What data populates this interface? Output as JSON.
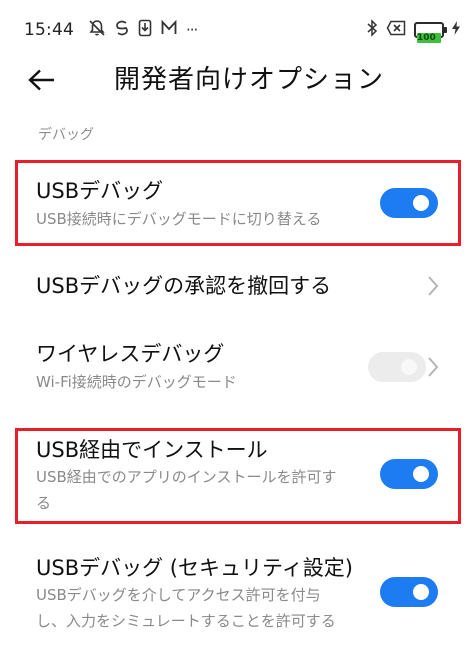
{
  "status_bar": {
    "time": "15:44",
    "left_icons": [
      "mute-icon",
      "sync-icon",
      "download-icon",
      "mail-icon"
    ],
    "more": "···",
    "right_icons": [
      "bluetooth-icon",
      "no-sim-icon"
    ],
    "battery_level": "100",
    "charging": true
  },
  "header": {
    "back": "back-arrow-icon",
    "title": "開発者向けオプション"
  },
  "section": {
    "label": "デバッグ"
  },
  "items": [
    {
      "title": "USBデバッグ",
      "subtitle": "USB接続時にデバッグモードに切り替える",
      "control": "toggle",
      "state": "on",
      "highlighted": true
    },
    {
      "title": "USBデバッグの承認を撤回する",
      "control": "chevron"
    },
    {
      "title": "ワイヤレスデバッグ",
      "subtitle": "Wi-Fi接続時のデバッグモード",
      "control": "toggle",
      "state": "disabled",
      "has_chevron": true
    },
    {
      "title": "USB経由でインストール",
      "subtitle_line1": "USB経由でのアプリのインストールを許可す",
      "subtitle_line2": "る",
      "control": "toggle",
      "state": "on",
      "highlighted": true
    },
    {
      "title": "USBデバッグ (セキュリティ設定)",
      "subtitle_line1": "USBデバッグを介してアクセス許可を付与",
      "subtitle_line2": "し、入力をシミュレートすることを許可する",
      "control": "toggle",
      "state": "on"
    }
  ],
  "colors": {
    "toggle_on": "#1e7cf2",
    "toggle_disabled": "#ececec",
    "highlight": "#e81e2a",
    "battery": "#3fbf3f"
  }
}
